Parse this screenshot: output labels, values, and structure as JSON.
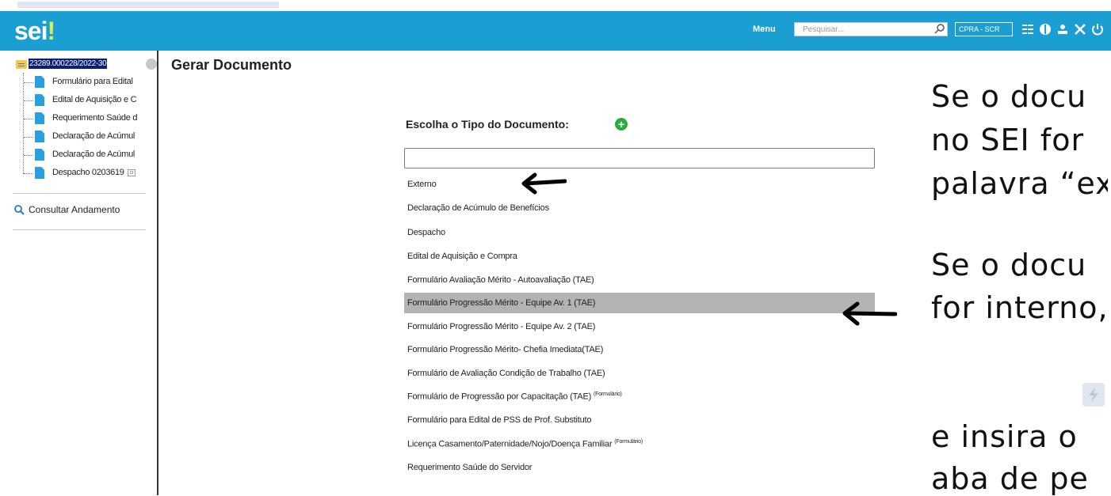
{
  "header": {
    "logo_main": "sei",
    "logo_bang": "!",
    "menu_label": "Menu",
    "search_placeholder": "Pesquisar...",
    "unit_label": "CPRA - SCR",
    "icons": [
      "search-icon",
      "grid-icon",
      "globe-icon",
      "user-icon",
      "tools-icon",
      "power-icon"
    ],
    "color": "#1b9ed2"
  },
  "sidebar": {
    "process_number": "23289.000228/2022-30",
    "documents": [
      {
        "label": "Formulário para Edital"
      },
      {
        "label": "Edital de Aquisição e C"
      },
      {
        "label": "Requerimento Saúde d"
      },
      {
        "label": "Declaração de Acúmul"
      },
      {
        "label": "Declaração de Acúmul"
      },
      {
        "label": "Despacho 0203619",
        "badge": "ci"
      }
    ],
    "consult_label": "Consultar Andamento"
  },
  "main": {
    "title": "Gerar Documento",
    "prompt": "Escolha o Tipo do Documento:",
    "options": [
      {
        "label": "Externo"
      },
      {
        "label": "Declaração de Acúmulo de Benefícios"
      },
      {
        "label": "Despacho"
      },
      {
        "label": "Edital de Aquisição e Compra"
      },
      {
        "label": "Formulário Avaliação Mérito - Autoavaliação (TAE)"
      },
      {
        "label": "Formulário Progressão Mérito - Equipe Av. 1 (TAE)",
        "selected": true
      },
      {
        "label": "Formulário Progressão Mérito - Equipe Av. 2 (TAE)"
      },
      {
        "label": "Formulário Progressão Mérito- Chefia Imediata(TAE)"
      },
      {
        "label": "Formulário de Avaliação Condição de Trabalho (TAE)"
      },
      {
        "label": "Formulário de Progressão por Capacitação (TAE)",
        "tag": "(Formulário)"
      },
      {
        "label": "Formulário para Edital de PSS de Prof. Substituto"
      },
      {
        "label": "Licença Casamento/Paternidade/Nojo/Doença Familiar",
        "tag": "(Formulário)"
      },
      {
        "label": "Requerimento Saúde do Servidor"
      }
    ]
  },
  "annotation": {
    "lines": [
      "Se o docu",
      "no SEI for",
      "palavra “ex",
      "Se o docu",
      "for interno,",
      "e insira o",
      "aba de pe"
    ]
  }
}
